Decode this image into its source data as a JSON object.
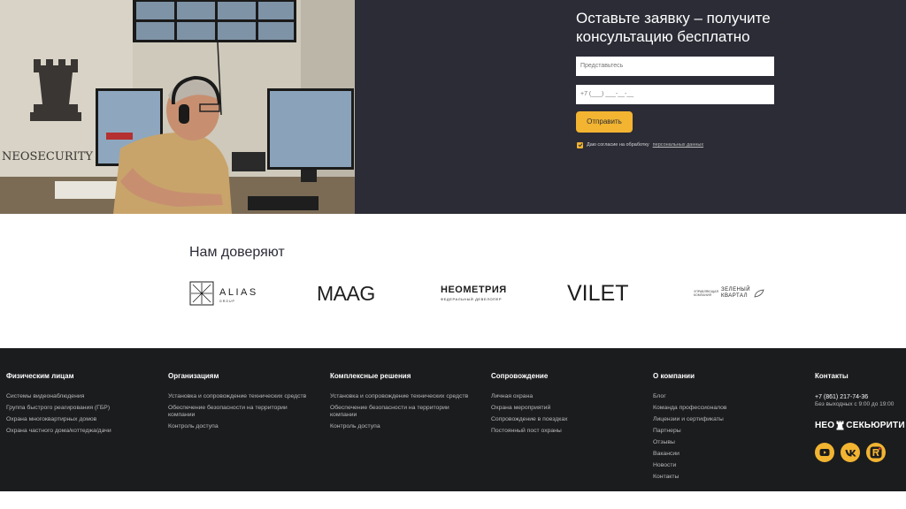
{
  "hero": {
    "title": "Оставьте заявку – получите консультацию бесплатно",
    "name_placeholder": "Представьтесь",
    "phone_placeholder": "+7 (___) ___-__-__",
    "submit_label": "Отправить",
    "consent_text": "Даю согласие на обработку",
    "consent_link": "персональных данных",
    "consent_checked": true,
    "photo_sign": "NEOSECURITY"
  },
  "trust": {
    "title": "Нам доверяют",
    "logos": {
      "alias_name": "ALIAS",
      "alias_sub": "GROUP",
      "maag": "MAAG",
      "neo_name": "НЕОМЕТРИЯ",
      "neo_sub": "ФЕДЕРАЛЬНЫЙ ДЕВЕЛОПЕР",
      "vilet": "VILET",
      "green_small": "УПРАВЛЯЮЩАЯ КОМПАНИЯ",
      "green_line1": "ЗЕЛЕНЫЙ",
      "green_line2": "КВАРТАЛ"
    }
  },
  "footer": {
    "col1": {
      "title": "Физическим лицам",
      "items": [
        "Системы видеонаблюдения",
        "Группа быстрого реагирования (ГБР)",
        "Охрана многоквартирных домов",
        "Охрана частного дома/коттеджа/дачи"
      ]
    },
    "col2": {
      "title": "Организациям",
      "items": [
        "Установка и сопровождение технических средств",
        "Обеспечение безопасности на территории компании",
        "Контроль доступа"
      ]
    },
    "col3": {
      "title": "Комплексные решения",
      "items": [
        "Установка и сопровождение технических средств",
        "Обеспечение безопасности на территории компании",
        "Контроль доступа"
      ]
    },
    "col4": {
      "title": "Сопровождение",
      "items": [
        "Личная охрана",
        "Охрана мероприятий",
        "Сопровождение в поездках",
        "Постоянный пост охраны"
      ]
    },
    "col5": {
      "title": "О компании",
      "items": [
        "Блог",
        "Команда профессионалов",
        "Лицензии и сертификаты",
        "Партнеры",
        "Отзывы",
        "Вакансии",
        "Новости",
        "Контакты"
      ]
    },
    "contacts": {
      "title": "Контакты",
      "phone": "+7 (861) 217-74-36",
      "hours": "Без выходных с 9:00 до 19:00",
      "brand_left": "НЕО",
      "brand_right": "СЕКЬЮРИТИ",
      "socials": [
        "youtube-icon",
        "vk-icon",
        "rutube-icon"
      ]
    }
  },
  "colors": {
    "accent": "#f2b431",
    "hero_bg": "#2b2c36",
    "footer_bg": "#1b1c1e"
  }
}
